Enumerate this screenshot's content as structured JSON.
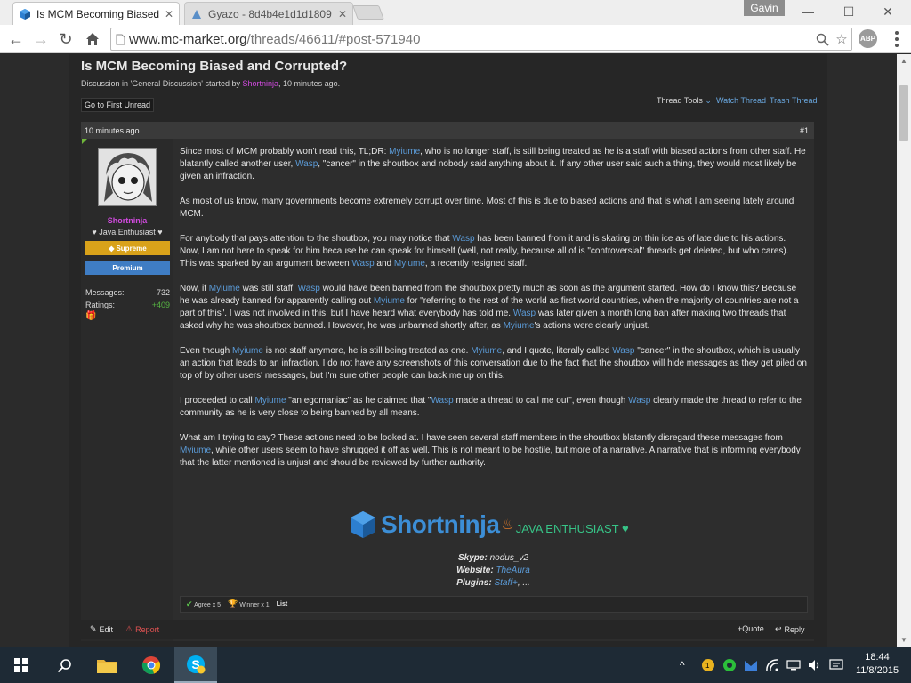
{
  "browser": {
    "tabs": [
      {
        "title": "Is MCM Becoming Biased",
        "active": true
      },
      {
        "title": "Gyazo - 8d4b4e1d1d1809",
        "active": false
      }
    ],
    "user": "Gavin",
    "url_host": "www.mc-market.org",
    "url_path": "/threads/46611/#post-571940",
    "abp_label": "ABP",
    "window_controls": {
      "minimize": "—",
      "maximize": "☐",
      "close": "✕"
    }
  },
  "thread": {
    "title": "Is MCM Becoming Biased and Corrupted?",
    "desc_prefix": "Discussion in 'General Discussion' started by ",
    "desc_starter": "Shortninja",
    "desc_suffix": ", 10 minutes ago.",
    "first_unread": "Go to First Unread",
    "tools": {
      "thread_tools": "Thread Tools",
      "watch": "Watch Thread",
      "trash": "Trash Thread"
    }
  },
  "post": {
    "time": "10 minutes ago",
    "number": "#1",
    "user": {
      "name": "Shortninja",
      "title": "♥ Java Enthusiast ♥",
      "banner_supreme": "Supreme",
      "banner_premium": "Premium",
      "messages_label": "Messages:",
      "messages": "732",
      "ratings_label": "Ratings:",
      "ratings": "+409"
    },
    "paragraphs": [
      [
        {
          "t": "Since most of MCM probably won't read this, TL;DR: "
        },
        {
          "t": "Myiume",
          "link": true
        },
        {
          "t": ", who is no longer staff, is still being treated as he is a staff with biased actions from other staff. He blatantly called another user, "
        },
        {
          "t": "Wasp",
          "link": true
        },
        {
          "t": ", \"cancer\" in the shoutbox and nobody said anything about it. If any other user said such a thing, they would most likely be given an infraction."
        }
      ],
      [
        {
          "t": "As most of us know, many governments become extremely corrupt over time. Most of this is due to biased actions and that is what I am seeing lately around MCM."
        }
      ],
      [
        {
          "t": "For anybody that pays attention to the shoutbox, you may notice that "
        },
        {
          "t": "Wasp",
          "link": true
        },
        {
          "t": " has been banned from it and is skating on thin ice as of late due to his actions. Now, I am not here to speak for him because he can speak for himself (well, not really, because all of is \"controversial\" threads get deleted, but who cares). This was sparked by an argument between "
        },
        {
          "t": "Wasp",
          "link": true
        },
        {
          "t": " and "
        },
        {
          "t": "Myiume",
          "link": true
        },
        {
          "t": ", a recently resigned staff."
        }
      ],
      [
        {
          "t": "Now, if "
        },
        {
          "t": "Myiume",
          "link": true
        },
        {
          "t": " was still staff, "
        },
        {
          "t": "Wasp",
          "link": true
        },
        {
          "t": " would have been banned from the shoutbox pretty much as soon as the argument started. How do I know this? Because he was already banned for apparently calling out "
        },
        {
          "t": "Myiume",
          "link": true
        },
        {
          "t": " for \"referring to the rest of the world as first world countries, when the majority of countries are not a part of this\". I was not involved in this, but I have heard what everybody has told me. "
        },
        {
          "t": "Wasp",
          "link": true
        },
        {
          "t": " was later given a month long ban after making two threads that asked why he was shoutbox banned. However, he was unbanned shortly after, as "
        },
        {
          "t": "Myiume",
          "link": true
        },
        {
          "t": "'s actions were clearly unjust."
        }
      ],
      [
        {
          "t": "Even though "
        },
        {
          "t": "Myiume",
          "link": true
        },
        {
          "t": " is not staff anymore, he is still being treated as one. "
        },
        {
          "t": "Myiume",
          "link": true
        },
        {
          "t": ", and I quote, literally called "
        },
        {
          "t": "Wasp",
          "link": true
        },
        {
          "t": " \"cancer\" in the shoutbox, which is usually an action that leads to an infraction. I do not have any screenshots of this conversation due to the fact that the shoutbox will hide messages as they get piled on top of by other users' messages, but I'm sure other people can back me up on this."
        }
      ],
      [
        {
          "t": "I proceeded to call "
        },
        {
          "t": "Myiume",
          "link": true
        },
        {
          "t": " \"an egomaniac\" as he claimed that \""
        },
        {
          "t": "Wasp",
          "link": true
        },
        {
          "t": " made a thread to call me out\", even though "
        },
        {
          "t": "Wasp",
          "link": true
        },
        {
          "t": " clearly made the thread to refer to the community as he is very close to being banned by all means."
        }
      ],
      [
        {
          "t": "What am I trying to say? These actions need to be looked at. I have seen several staff members in the shoutbox blatantly disregard these messages from "
        },
        {
          "t": "Myiume",
          "link": true
        },
        {
          "t": ", while other users seem to have shrugged it off as well. This is not meant to be hostile, but more of a narrative. A narrative that is informing everybody that the latter mentioned is unjust and should be reviewed by further authority."
        }
      ]
    ],
    "signature": {
      "logo_name": "Shortninja",
      "logo_tag": "JAVA ENTHUSIAST ♥",
      "skype_label": "Skype:",
      "skype": "nodus_v2",
      "website_label": "Website:",
      "website": "TheAura",
      "plugins_label": "Plugins:",
      "plugins_link": "Staff+",
      "plugins_more": ", ..."
    },
    "likes": {
      "agree": "Agree x 5",
      "winner": "Winner x 1",
      "list": "List"
    },
    "actions": {
      "edit": "Edit",
      "report": "Report",
      "quote": "+Quote",
      "reply": "Reply"
    }
  },
  "taskbar": {
    "tray_badge": "1",
    "time": "18:44",
    "date": "11/8/2015"
  },
  "colors": {
    "link": "#5b9bd8",
    "username": "#d14adf",
    "supreme": "#d9a21a",
    "premium": "#3f7dc4",
    "report": "#e05252"
  }
}
